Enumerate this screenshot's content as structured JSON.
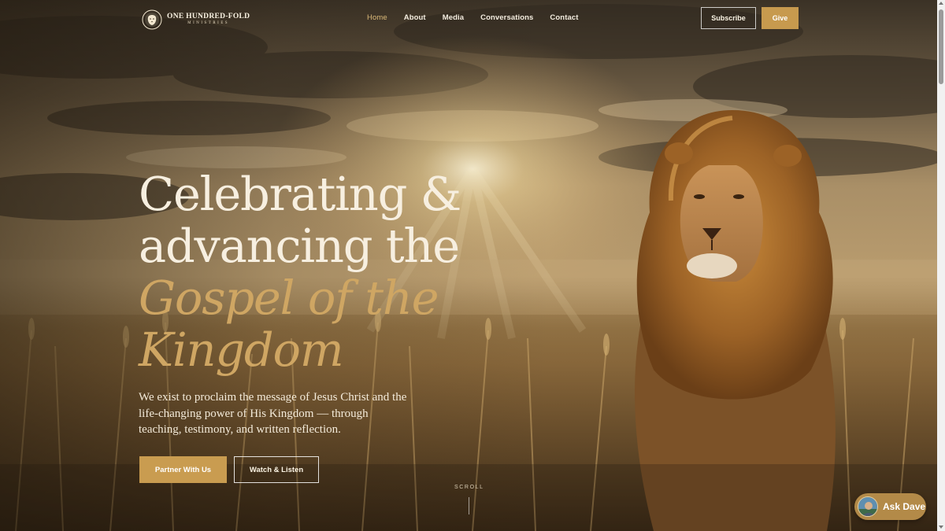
{
  "brand": {
    "name": "ONE HUNDRED-FOLD",
    "sub": "MINISTRIES",
    "logo_icon": "lion-crest-icon"
  },
  "nav": {
    "items": [
      {
        "label": "Home",
        "active": true
      },
      {
        "label": "About"
      },
      {
        "label": "Media"
      },
      {
        "label": "Conversations"
      },
      {
        "label": "Contact"
      }
    ]
  },
  "header_actions": {
    "subscribe": "Subscribe",
    "give": "Give"
  },
  "hero": {
    "title_line1": "Celebrating &",
    "title_line2": "advancing the",
    "title_accent1": "Gospel of the",
    "title_accent2": "Kingdom",
    "description": "We exist to proclaim the message of Jesus Christ and the life-changing power of His Kingdom — through teaching, testimony, and written reflection.",
    "primary_cta": "Partner With Us",
    "secondary_cta": "Watch & Listen",
    "scroll_hint": "SCROLL"
  },
  "chat_widget": {
    "label": "Ask Dave",
    "avatar_icon": "avatar-icon"
  },
  "colors": {
    "accent_gold": "#c99c50",
    "title_gold": "#cfa663",
    "text_light": "#f7efe0"
  }
}
